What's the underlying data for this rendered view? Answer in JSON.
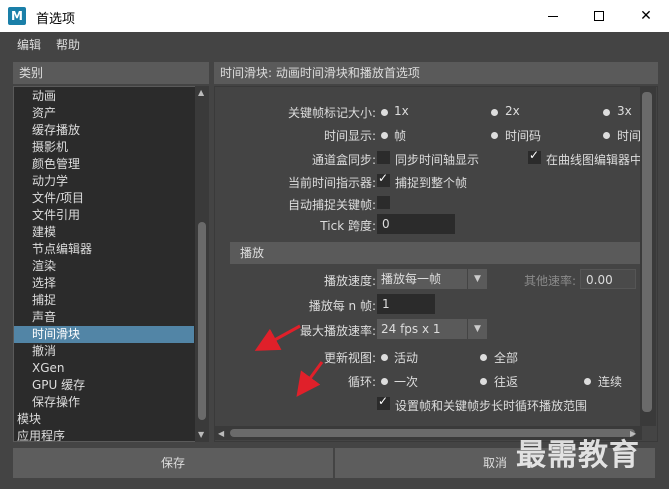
{
  "window": {
    "title": "首选项",
    "app_icon": "M"
  },
  "menu": {
    "items": [
      "编辑",
      "帮助"
    ]
  },
  "categories": {
    "header": "类别",
    "items": [
      "动画",
      "资产",
      "缓存播放",
      "摄影机",
      "颜色管理",
      "动力学",
      "文件/项目",
      "文件引用",
      "建模",
      "节点编辑器",
      "渲染",
      "选择",
      "捕捉",
      "声音",
      "时间滑块",
      "撤消",
      "XGen",
      "GPU 缓存",
      "保存操作",
      "模块",
      "应用程序"
    ],
    "selected": "时间滑块"
  },
  "panel": {
    "title": "时间滑块: 动画时间滑块和播放首选项",
    "keyticks": {
      "label": "关键帧标记大小:",
      "options": [
        "1x",
        "2x",
        "3x"
      ]
    },
    "time_display": {
      "label": "时间显示:",
      "options": [
        "帧",
        "时间码",
        "时间"
      ]
    },
    "channel_sync": {
      "label": "通道盒同步:",
      "opt1": "同步时间轴显示",
      "opt2": "在曲线图编辑器中"
    },
    "current_time_indicator": {
      "label": "当前时间指示器:",
      "option": "捕捉到整个帧"
    },
    "auto_snap": {
      "label": "自动捕捉关键帧:"
    },
    "tick_span": {
      "label": "Tick 跨度:",
      "value": "0"
    },
    "playback": {
      "section_title": "播放",
      "speed": {
        "label": "播放速度:",
        "value": "播放每一帧",
        "other_label": "其他速率:",
        "other_value": "0.00"
      },
      "play_every": {
        "label": "播放每 n 帧:",
        "value": "1"
      },
      "max_rate": {
        "label": "最大播放速率:",
        "value": "24 fps x 1"
      },
      "update_view": {
        "label": "更新视图:",
        "options": [
          "活动",
          "全部"
        ]
      },
      "looping": {
        "label": "循环:",
        "options": [
          "一次",
          "往返",
          "连续"
        ]
      },
      "set_range": {
        "label": "设置帧和关键帧步长时循环播放范围"
      }
    }
  },
  "buttons": {
    "save": "保存",
    "cancel": "取消"
  },
  "watermark": "最需教育",
  "colors": {
    "selection": "#5285a6",
    "annotation_arrow": "#e0202a"
  }
}
